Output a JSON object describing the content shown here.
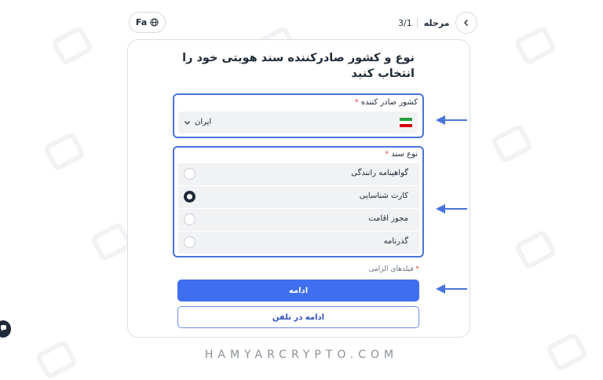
{
  "header": {
    "language_label": "Fa",
    "step_label": "مرحله",
    "step_count": "3/1"
  },
  "form": {
    "title": "نوع و کشور صادرکننده سند هویتی خود را انتخاب کنید",
    "country": {
      "label": "کشور صادر کننده",
      "required_mark": "*",
      "value": "ایران"
    },
    "document_type": {
      "label": "نوع سند",
      "required_mark": "*",
      "options": [
        {
          "label": "گواهینامه رانندگی",
          "selected": false
        },
        {
          "label": "کارت شناسایی",
          "selected": true
        },
        {
          "label": "مجوز اقامت",
          "selected": false
        },
        {
          "label": "گذرنامه",
          "selected": false
        }
      ]
    },
    "required_note": "فیلدهای الزامی",
    "required_note_mark": "*",
    "continue_label": "ادامه",
    "continue_on_phone_label": "ادامه در تلفن"
  },
  "footer": {
    "brand": "HAMYARCRYPTO.COM"
  },
  "colors": {
    "accent": "#3f6ef0",
    "highlight_border": "#4a74d9",
    "required": "#e14b4b"
  }
}
